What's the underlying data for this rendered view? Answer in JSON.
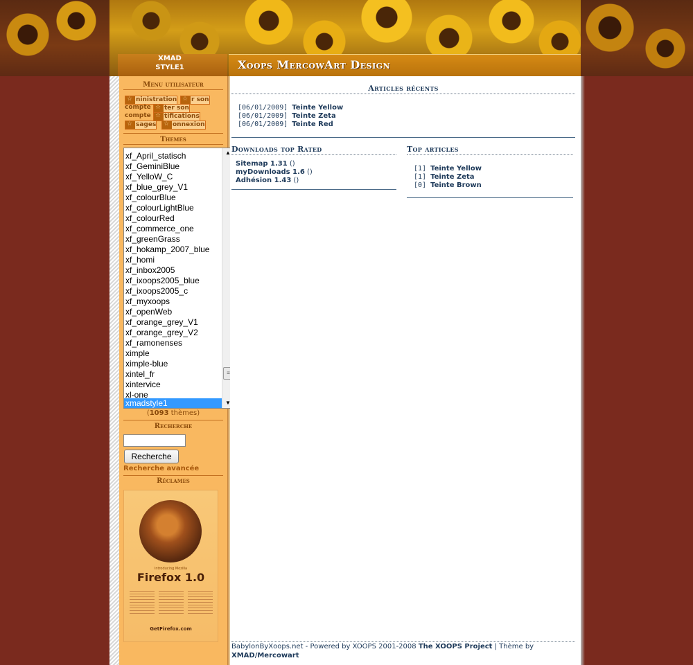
{
  "header": {
    "site_name_line1": "XMAD",
    "site_name_line2": "STYLE1",
    "logo_text": "Xoops MercowArt Design"
  },
  "sidebar": {
    "user_menu_title": "Menu utilisateur",
    "user_menu_items": [
      {
        "label": "ninistration"
      },
      {
        "label": "r son"
      },
      {
        "label": "compte"
      },
      {
        "label": "ter son"
      },
      {
        "label": "compte"
      },
      {
        "label": "tifications"
      },
      {
        "label": "sages"
      },
      {
        "label": "onnexion"
      }
    ],
    "themes_title": "Themes",
    "themes": [
      "xf_April_statisch",
      "xf_GeminiBlue",
      "xf_YelloW_C",
      "xf_blue_grey_V1",
      "xf_colourBlue",
      "xf_colourLightBlue",
      "xf_colourRed",
      "xf_commerce_one",
      "xf_greenGrass",
      "xf_hokamp_2007_blue",
      "xf_homi",
      "xf_inbox2005",
      "xf_ixoops2005_blue",
      "xf_ixoops2005_c",
      "xf_myxoops",
      "xf_openWeb",
      "xf_orange_grey_V1",
      "xf_orange_grey_V2",
      "xf_ramonenses",
      "ximple",
      "ximple-blue",
      "xintel_fr",
      "xintervice",
      "xl-one",
      "xmadstyle1"
    ],
    "selected_theme": "xmadstyle1",
    "theme_count_open": "(",
    "theme_count_value": "1093",
    "theme_count_suffix": " thèmes)",
    "search_title": "Recherche",
    "search_value": "",
    "search_button": "Recherche",
    "advanced_search": "Recherche avancée",
    "ads_title": "Réclames",
    "ad": {
      "product": "Firefox 1.0",
      "tagline": "Introducing Mozilla",
      "cta": "GetFirefox.com"
    }
  },
  "main": {
    "recent_title": "Articles récents",
    "recent_articles": [
      {
        "date": "[06/01/2009]",
        "title": "Teinte Yellow"
      },
      {
        "date": "[06/01/2009]",
        "title": "Teinte Zeta"
      },
      {
        "date": "[06/01/2009]",
        "title": "Teinte Red"
      }
    ],
    "downloads_title": "Downloads top Rated",
    "downloads": [
      {
        "name": "Sitemap 1.31",
        "extra": " ()"
      },
      {
        "name": "myDownloads 1.6",
        "extra": " ()"
      },
      {
        "name": "Adhésion 1.43",
        "extra": " ()"
      }
    ],
    "top_title": "Top articles",
    "top_articles": [
      {
        "rank": "[1]",
        "title": "Teinte Yellow"
      },
      {
        "rank": "[1]",
        "title": "Teinte Zeta"
      },
      {
        "rank": "[0]",
        "title": "Teinte Brown"
      }
    ]
  },
  "footer": {
    "text1": "BabylonByXoops.net - Powered by XOOPS 2001-2008 ",
    "link1": "The XOOPS Project",
    "text2": " | Thème by ",
    "link2": "XMAD/Mercowart"
  },
  "colors": {
    "background": "#7a2a1e",
    "sidebar": "#f9b860",
    "accent_title": "#1e3a5a",
    "selected": "#3399ff"
  }
}
